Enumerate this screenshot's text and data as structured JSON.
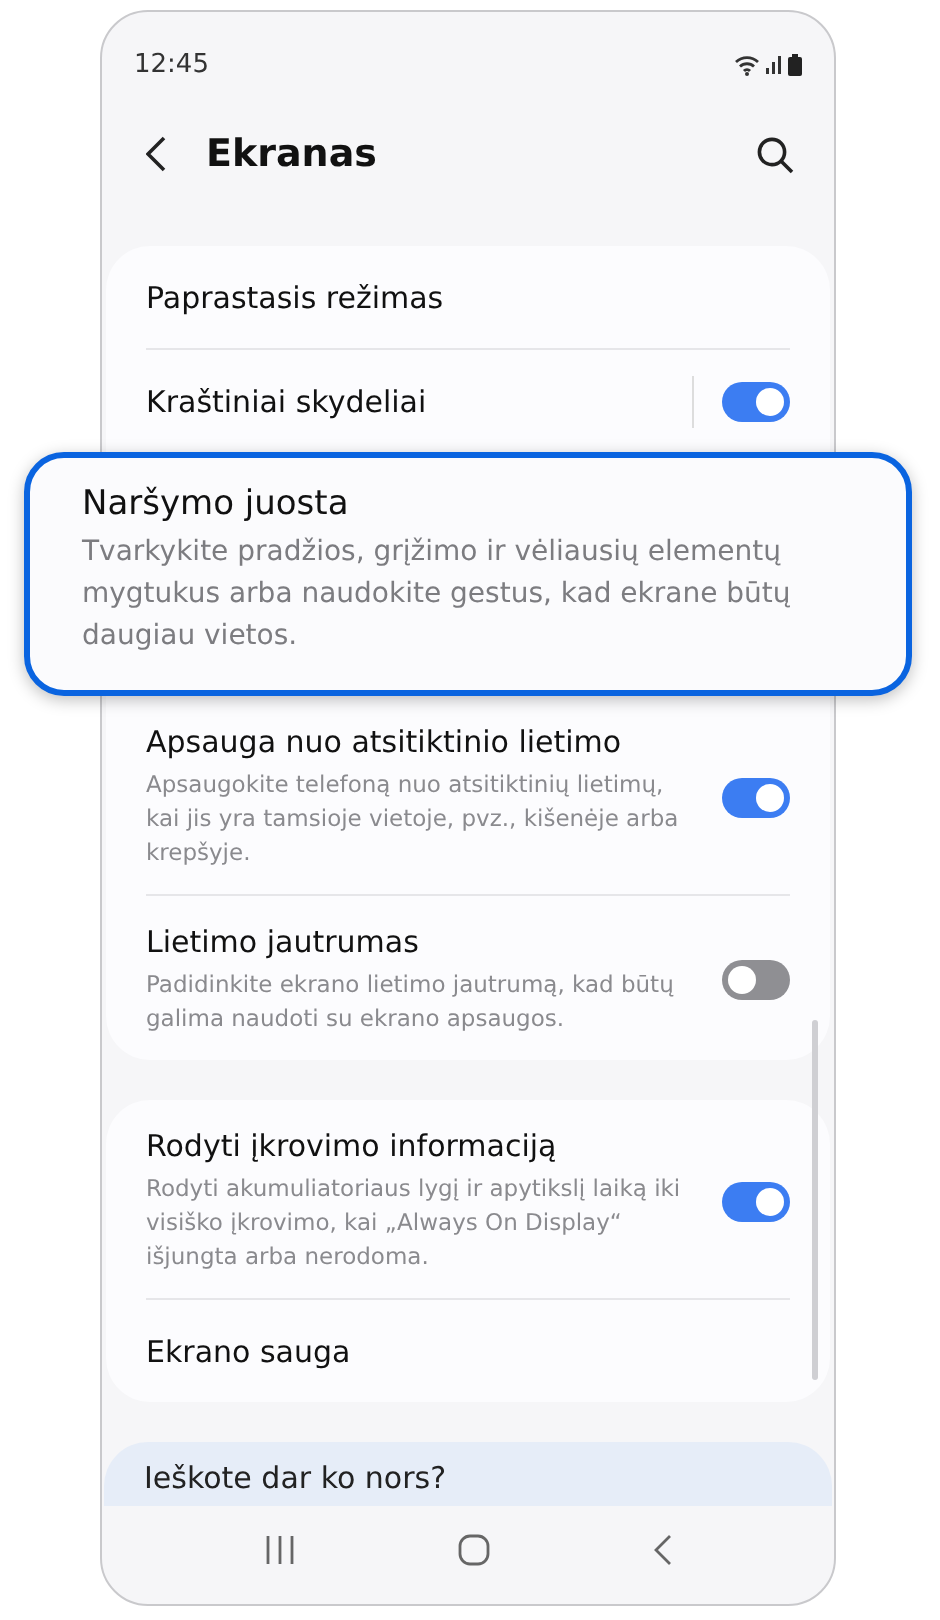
{
  "status_bar": {
    "time": "12:45"
  },
  "header": {
    "title": "Ekranas"
  },
  "sections": [
    {
      "items": [
        {
          "kind": "plain",
          "title": "Paprastasis režimas"
        },
        {
          "kind": "toggle",
          "title": "Kraštiniai skydeliai",
          "on": true,
          "divider": true
        },
        {
          "kind": "highlight",
          "title": "Naršymo juosta",
          "subtitle": "Tvarkykite pradžios, grįžimo ir vėliausių elementų mygtukus arba naudokite gestus, kad ekrane būtų daugiau vietos."
        },
        {
          "kind": "toggle",
          "title": "Apsauga nuo atsitiktinio lietimo",
          "subtitle": "Apsaugokite telefoną nuo atsitiktinių lietimų, kai jis yra tamsioje vietoje, pvz., kišenėje arba krepšyje.",
          "on": true
        },
        {
          "kind": "toggle",
          "title": "Lietimo jautrumas",
          "subtitle": "Padidinkite ekrano lietimo jautrumą, kad būtų galima naudoti su ekrano apsaugos.",
          "on": false
        }
      ]
    },
    {
      "items": [
        {
          "kind": "toggle",
          "title": "Rodyti įkrovimo informaciją",
          "subtitle": "Rodyti akumuliatoriaus lygį ir apytikslį laiką iki visiško įkrovimo, kai „Always On Display“ išjungta arba nerodoma.",
          "on": true
        },
        {
          "kind": "plain",
          "title": "Ekrano sauga"
        }
      ]
    }
  ],
  "suggestion": {
    "text": "Ieškote dar ko nors?"
  }
}
